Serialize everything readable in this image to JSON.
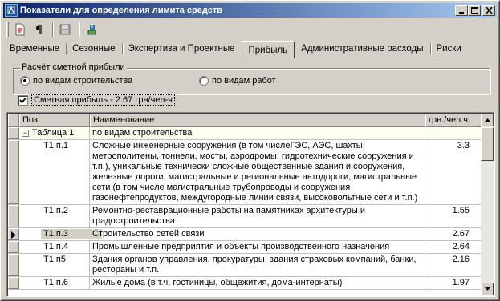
{
  "window": {
    "title": "Показатели для определения лимита средств",
    "controls": [
      "minimize",
      "maximize",
      "close"
    ]
  },
  "toolbar": {
    "icons": [
      "document-red-icon",
      "paragraph-icon",
      "save-disk-icon",
      "export-icon"
    ]
  },
  "tabs": [
    {
      "label": "Временные",
      "active": false
    },
    {
      "label": "Сезонные",
      "active": false
    },
    {
      "label": "Экспертиза и Проектные",
      "active": false
    },
    {
      "label": "Прибыль",
      "active": true
    },
    {
      "label": "Административные расходы",
      "active": false
    },
    {
      "label": "Риски",
      "active": false
    }
  ],
  "profit_group": {
    "legend": "Расчёт сметной прибыли",
    "option_construction": "по видам строительства",
    "option_works": "по видам работ",
    "selected": "по видам строительства"
  },
  "estimate_checkbox": {
    "label": "Сметная прибыль - 2.67 грн/чел-ч",
    "checked": true
  },
  "grid": {
    "columns": {
      "pos": "Поз.",
      "name": "Наименование",
      "value": "грн./чел.ч."
    },
    "group_row": {
      "pos": "Таблица 1",
      "name": "по видам строительства",
      "expander": "−"
    },
    "rows": [
      {
        "pos": "Т1.п.1",
        "name": "Сложные инженерные сооружения (в том числеГЭС, АЭС,  шахты, метрополитены, тоннели, мосты, аэродромы, гидротехнические сооружения и т.п.), уникальные технически сложные общественные здания и сооружения, железные дороги,  магистральные и региональные автодороги, магистральные сети (в том числе магистральные трубопроводы и сооружения газонефтепродуктов, междугородные линии связи, высоковольтные сети и т.п.)",
        "value": "3.3"
      },
      {
        "pos": "Т1.п.2",
        "name": "Ремонтно-реставрационные работы на памятниках архитектуры и градостроительства",
        "value": "1.55"
      },
      {
        "pos": "Т1.п.3",
        "name": "Строительство сетей связи",
        "value": "2.67",
        "selected": true
      },
      {
        "pos": "Т1.п.4",
        "name": "Промышленные предприятия и объекты производственного назначения",
        "value": "2.64"
      },
      {
        "pos": "Т1.п5",
        "name": "Здания органов управления, прокуратуры, здания страховых компаний, банки, рестораны и т.п.",
        "value": "2.16"
      },
      {
        "pos": "Т1.п.6",
        "name": "Жилые дома (в т.ч. гостиницы, общежития, дома-интернаты)",
        "value": "1.97"
      }
    ]
  }
}
